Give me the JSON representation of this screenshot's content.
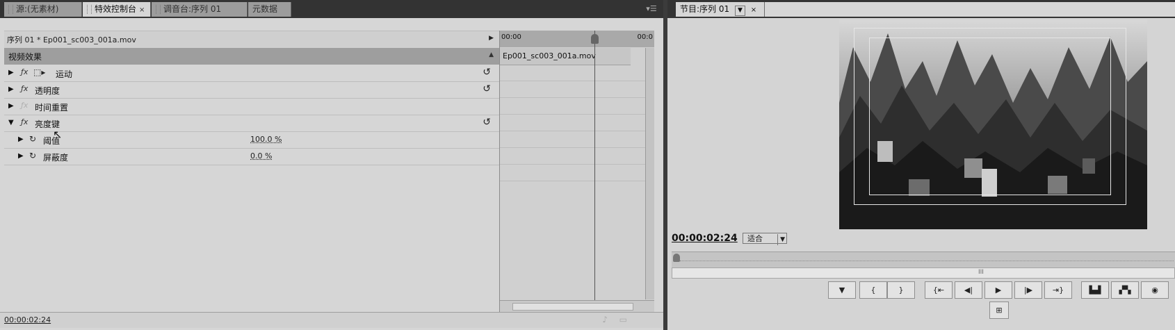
{
  "left_panel": {
    "tabs": [
      {
        "label": "源:(无素材)",
        "active": false
      },
      {
        "label": "特效控制台",
        "active": true
      },
      {
        "label": "调音台:序列 01",
        "active": false
      },
      {
        "label": "元数据",
        "active": false
      }
    ],
    "sequence_label": "序列 01 * Ep001_sc003_001a.mov",
    "section_title": "视频效果",
    "effects": [
      {
        "name": "运动",
        "has_reset": true,
        "fx_enabled": true,
        "has_motion_icon": true
      },
      {
        "name": "透明度",
        "has_reset": true,
        "fx_enabled": true
      },
      {
        "name": "时间重置",
        "has_reset": false,
        "fx_enabled": false
      },
      {
        "name": "亮度键",
        "has_reset": true,
        "fx_enabled": true,
        "expanded": true
      }
    ],
    "params": [
      {
        "name": "阈值",
        "value": "100.0 %"
      },
      {
        "name": "屏蔽度",
        "value": "0.0 %"
      }
    ],
    "timeline": {
      "start_time": "00:00",
      "end_time": "00:0",
      "clip_name": "Ep001_sc003_001a.mov"
    },
    "current_timecode": "00:00:02:24"
  },
  "right_panel": {
    "tab_label": "节目:序列 01",
    "timecode": "00:00:02:24",
    "fit_label": "适合"
  },
  "icons": {
    "tab_grip": "grip-icon",
    "panel_menu": "panel-menu-icon",
    "reset": "reset-icon",
    "stopwatch": "stopwatch-icon",
    "motion": "motion-transform-icon"
  }
}
